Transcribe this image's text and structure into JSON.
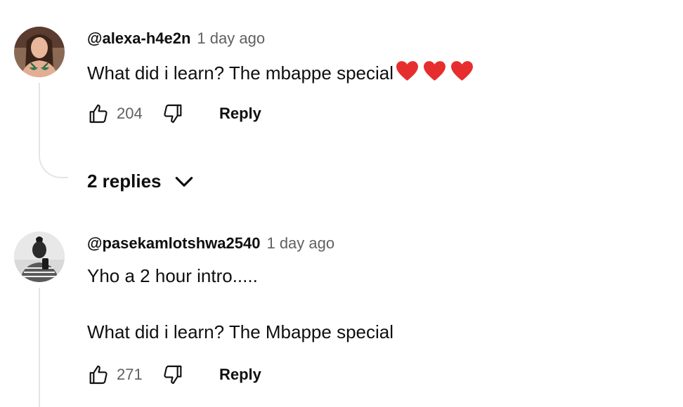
{
  "comments": [
    {
      "author": "@alexa-h4e2n",
      "time": "1 day ago",
      "text": "What did i learn? The mbappe special",
      "hearts": [
        "❤",
        "❤",
        "❤"
      ],
      "likes": "204",
      "reply_label": "Reply",
      "replies_label": "2 replies"
    },
    {
      "author": "@pasekamlotshwa2540",
      "time": "1 day ago",
      "text_line1": "Yho a 2 hour intro.....",
      "text_line2": "What did i learn? The Mbappe special",
      "likes": "271",
      "reply_label": "Reply"
    }
  ],
  "colors": {
    "heart": "#e62e2e",
    "secondary_text": "#606060",
    "thread_line": "#e5e5e5"
  }
}
